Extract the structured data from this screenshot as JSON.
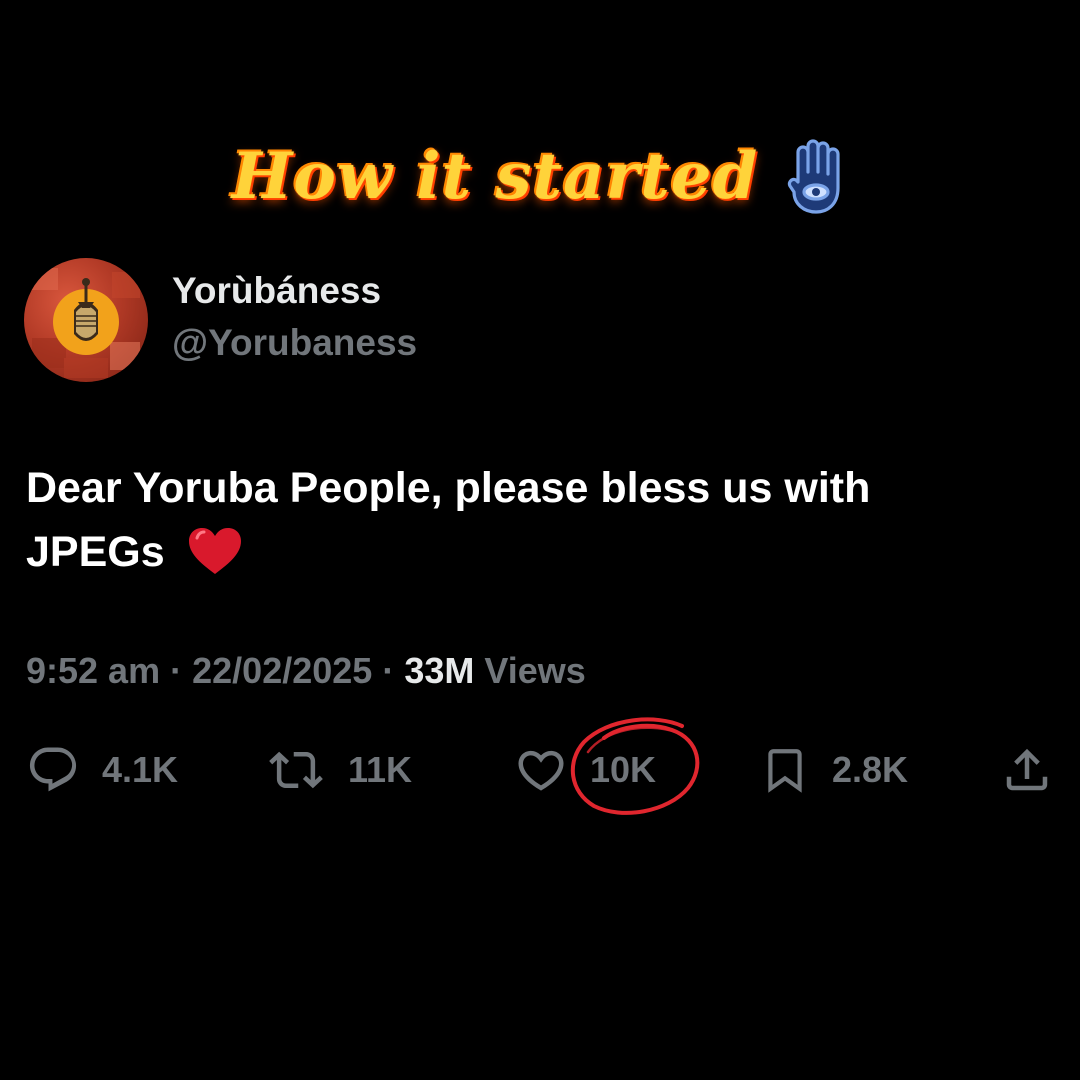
{
  "caption": {
    "text": "How it started",
    "emoji_icon": "hamsa-icon"
  },
  "account": {
    "display_name": "Yorùbáness",
    "handle": "@Yorubaness",
    "avatar_icon": "ife-bronze-head-avatar"
  },
  "tweet": {
    "line1": "Dear Yoruba People, please bless us with",
    "line2": "JPEGs",
    "emoji_icon": "red-heart-emoji"
  },
  "meta": {
    "time": "9:52 am",
    "separator": "·",
    "date": "22/02/2025",
    "views_count": "33M",
    "views_label": "Views"
  },
  "actions": {
    "reply": {
      "icon": "reply-icon",
      "count": "4.1K"
    },
    "repost": {
      "icon": "repost-icon",
      "count": "11K"
    },
    "like": {
      "icon": "heart-icon",
      "count": "10K"
    },
    "bookmark": {
      "icon": "bookmark-icon",
      "count": "2.8K"
    },
    "share": {
      "icon": "share-icon"
    }
  },
  "annotation": {
    "type": "hand-drawn-circle",
    "target": "like-count",
    "color": "#e0262e"
  },
  "colors": {
    "background": "#000000",
    "primary_text": "#e7e9ea",
    "secondary_text": "#71767b",
    "caption_fill": "#ffd33a",
    "caption_glow": "#ff5a00"
  }
}
